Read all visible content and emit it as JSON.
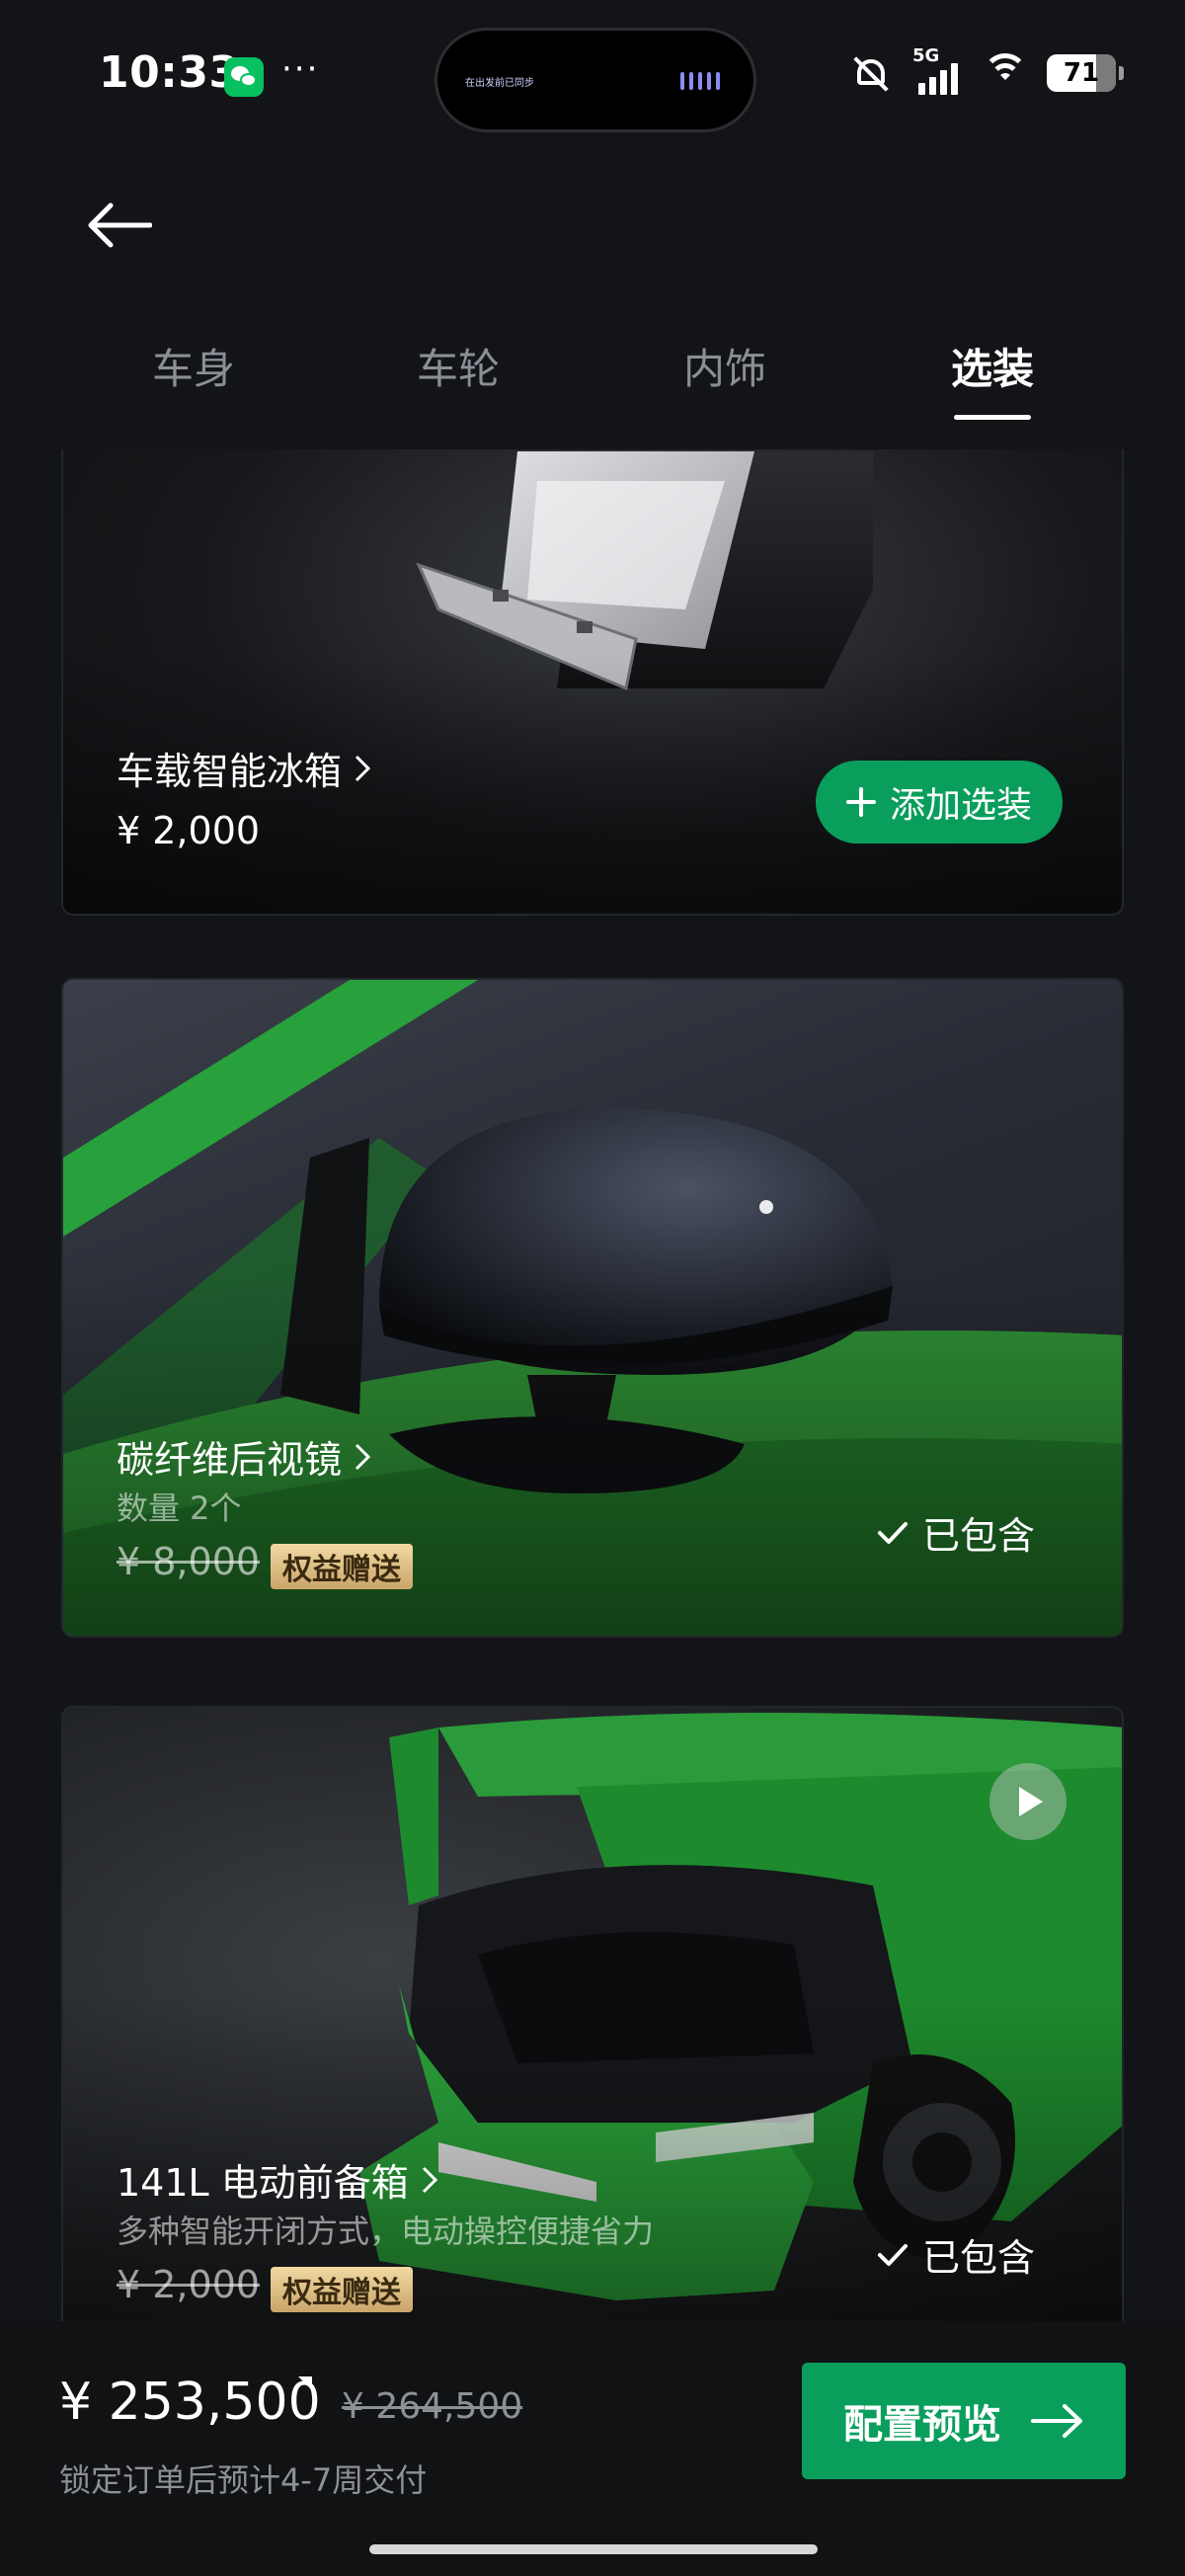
{
  "status_bar": {
    "time": "10:33",
    "more": "···",
    "island_text": "在出发前已同步",
    "network": "5G",
    "battery": "71"
  },
  "tabs": [
    {
      "label": "车身"
    },
    {
      "label": "车轮"
    },
    {
      "label": "内饰"
    },
    {
      "label": "选装",
      "active": true
    }
  ],
  "options": [
    {
      "title": "车载智能冰箱",
      "price": "¥ 2,000",
      "action": "添加选装"
    },
    {
      "title": "碳纤维后视镜",
      "subtitle": "数量 2个",
      "price": "¥ 8,000",
      "badge": "权益赠送",
      "status": "已包含"
    },
    {
      "title": "141L 电动前备箱",
      "subtitle": "多种智能开闭方式，电动操控便捷省力",
      "price": "¥ 2,000",
      "badge": "权益赠送",
      "status": "已包含"
    }
  ],
  "footer": {
    "total_price": "¥ 253,500",
    "original_price": "¥ 264,500",
    "delivery_note": "锁定订单后预计4-7周交付",
    "preview_label": "配置预览"
  },
  "colors": {
    "accent_green": "#0a9e5c",
    "background": "#131417",
    "badge_gold": "#caa56a"
  },
  "icons": [
    "back-arrow-icon",
    "chevron-right-icon",
    "plus-icon",
    "check-icon",
    "play-icon",
    "arrow-right-icon"
  ]
}
